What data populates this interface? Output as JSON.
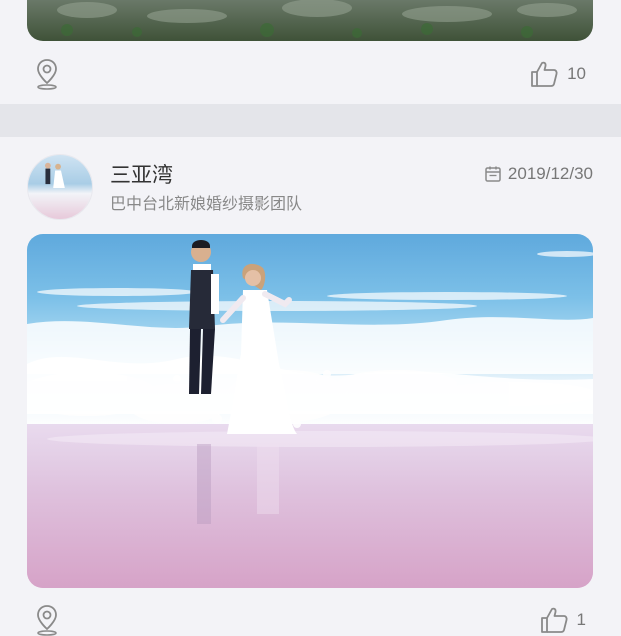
{
  "previous_post": {
    "like_count": "10",
    "location_icon": "location-pin-icon",
    "like_icon": "thumbs-up-icon"
  },
  "post": {
    "title": "三亚湾",
    "subtitle": "巴中台北新娘婚纱摄影团队",
    "date": "2019/12/30",
    "date_icon": "calendar-icon",
    "like_count": "1",
    "location_icon": "location-pin-icon",
    "like_icon": "thumbs-up-icon"
  },
  "colors": {
    "background": "#f3f3f7",
    "divider": "#e4e5ea",
    "text_primary": "#333333",
    "text_secondary": "#888888",
    "icon": "#8a8a8a"
  }
}
